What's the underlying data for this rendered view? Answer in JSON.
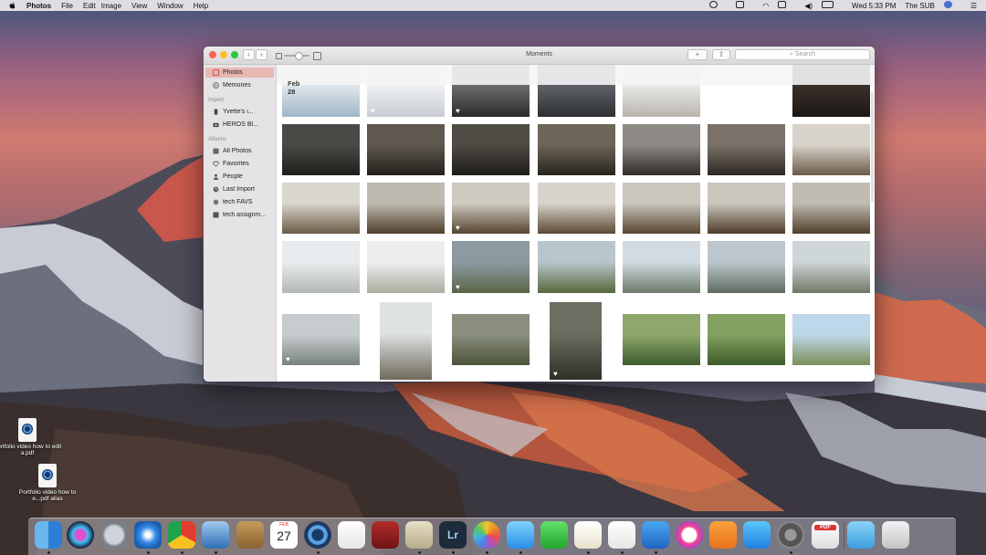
{
  "menubar": {
    "app": "Photos",
    "menus": [
      "File",
      "Edit",
      "Image",
      "View",
      "Window",
      "Help"
    ],
    "clock": "Wed 5:33 PM",
    "user": "The SUB"
  },
  "window": {
    "title": "Moments",
    "search_placeholder": "Search",
    "add_label": "+",
    "date_header": "Feb 28",
    "date_chevron": "›"
  },
  "sidebar": {
    "top_items": [
      {
        "label": "Photos",
        "icon": "photos-icon",
        "selected": true
      },
      {
        "label": "Memories",
        "icon": "memories-icon",
        "selected": false
      }
    ],
    "import_header": "Import",
    "import_items": [
      {
        "label": "Yvette's i...",
        "icon": "iphone-icon"
      },
      {
        "label": "HEROS Bl...",
        "icon": "camera-icon"
      }
    ],
    "albums_header": "Albums",
    "album_items": [
      {
        "label": "All Photos",
        "icon": "grid-icon"
      },
      {
        "label": "Favorites",
        "icon": "heart-icon"
      },
      {
        "label": "People",
        "icon": "person-icon"
      },
      {
        "label": "Last Import",
        "icon": "clock-icon"
      },
      {
        "label": "tech FAVS",
        "icon": "album-icon"
      },
      {
        "label": "tech assignm...",
        "icon": "album-icon"
      }
    ]
  },
  "desktop_icons": [
    {
      "label": "Portfolio video how to edit a.pdf"
    },
    {
      "label": "Portfolio video how to e...pdf alias"
    }
  ],
  "dock_apps": [
    "Finder",
    "Siri",
    "Launchpad",
    "Safari",
    "Chrome",
    "Preview",
    "Contacts",
    "Notes",
    "QuickTime Player",
    "Reminders",
    "Photo Booth",
    "Photos Library",
    "Lightroom",
    "Photos",
    "Messages",
    "FaceTime",
    "TextEdit",
    "Numbers",
    "Keynote",
    "iTunes",
    "iBooks",
    "App Store",
    "System Preferences",
    "PDF",
    "Folder",
    "Trash"
  ],
  "calendar": {
    "month": "FEB",
    "day": "27"
  },
  "lightroom_label": "Lr",
  "pdf_label": "PDF",
  "heart_glyph": "♥",
  "colors": {
    "sidebar_selection": "#e8b8b3",
    "accent": "#d1625a"
  }
}
